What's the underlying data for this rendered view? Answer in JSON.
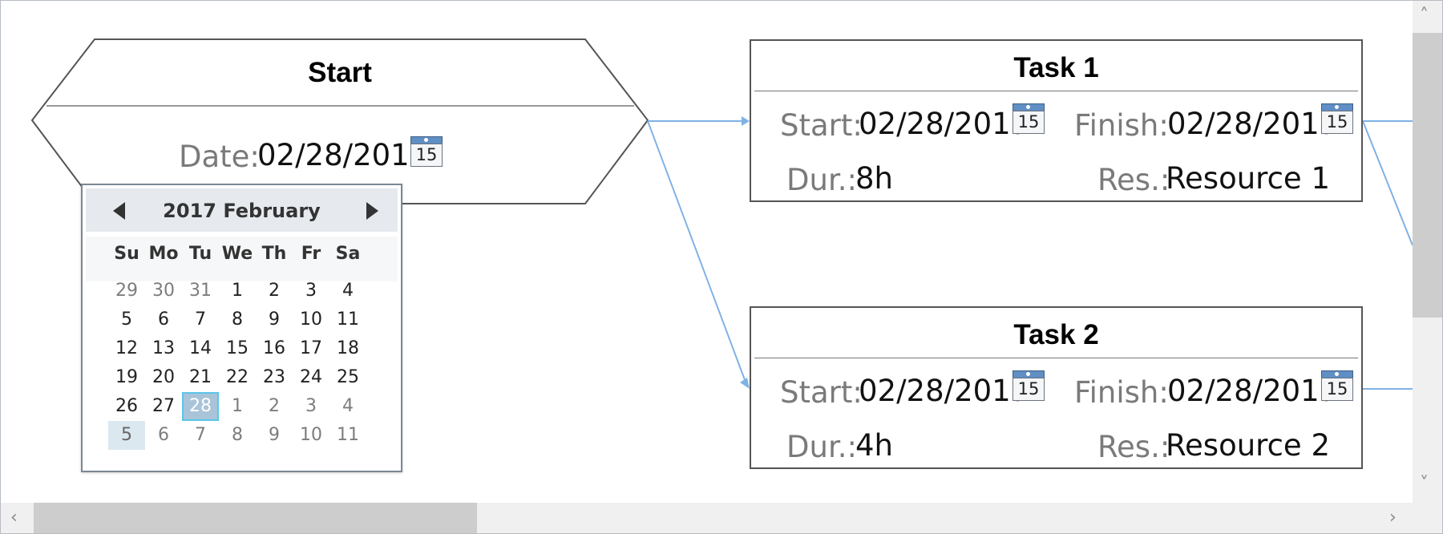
{
  "start_node": {
    "title": "Start",
    "date_label": "Date:",
    "date_value": "02/28/2017"
  },
  "tasks": [
    {
      "title": "Task 1",
      "start_label": "Start:",
      "start_value": "02/28/2017",
      "finish_label": "Finish:",
      "finish_value": "02/28/2017",
      "dur_label": "Dur.:",
      "dur_value": "8h",
      "res_label": "Res.:",
      "res_value": "Resource 1"
    },
    {
      "title": "Task 2",
      "start_label": "Start:",
      "start_value": "02/28/2017",
      "finish_label": "Finish:",
      "finish_value": "02/28/2017",
      "dur_label": "Dur.:",
      "dur_value": "4h",
      "res_label": "Res.:",
      "res_value": "Resource 2"
    }
  ],
  "calendar_icon_text": "15",
  "calendar": {
    "title": "2017 February",
    "days_of_week": [
      "Su",
      "Mo",
      "Tu",
      "We",
      "Th",
      "Fr",
      "Sa"
    ],
    "weeks": [
      [
        "29",
        "30",
        "31",
        "1",
        "2",
        "3",
        "4"
      ],
      [
        "5",
        "6",
        "7",
        "8",
        "9",
        "10",
        "11"
      ],
      [
        "12",
        "13",
        "14",
        "15",
        "16",
        "17",
        "18"
      ],
      [
        "19",
        "20",
        "21",
        "22",
        "23",
        "24",
        "25"
      ],
      [
        "26",
        "27",
        "28",
        "1",
        "2",
        "3",
        "4"
      ],
      [
        "5",
        "6",
        "7",
        "8",
        "9",
        "10",
        "11"
      ]
    ],
    "selected_day": "28",
    "today_day": "5"
  },
  "colors": {
    "link": "#7fb2e5",
    "node_border": "#555555",
    "selected_bg": "#a9c4d8",
    "selected_border": "#5cc5e8",
    "today_bg": "#dbe8f0"
  },
  "icons": {
    "calendar": "calendar-icon",
    "prev_month": "chevron-left-icon",
    "next_month": "chevron-right-icon",
    "scroll_up": "chevron-up-icon",
    "scroll_down": "chevron-down-icon",
    "scroll_left": "chevron-left-icon",
    "scroll_right": "chevron-right-icon"
  }
}
